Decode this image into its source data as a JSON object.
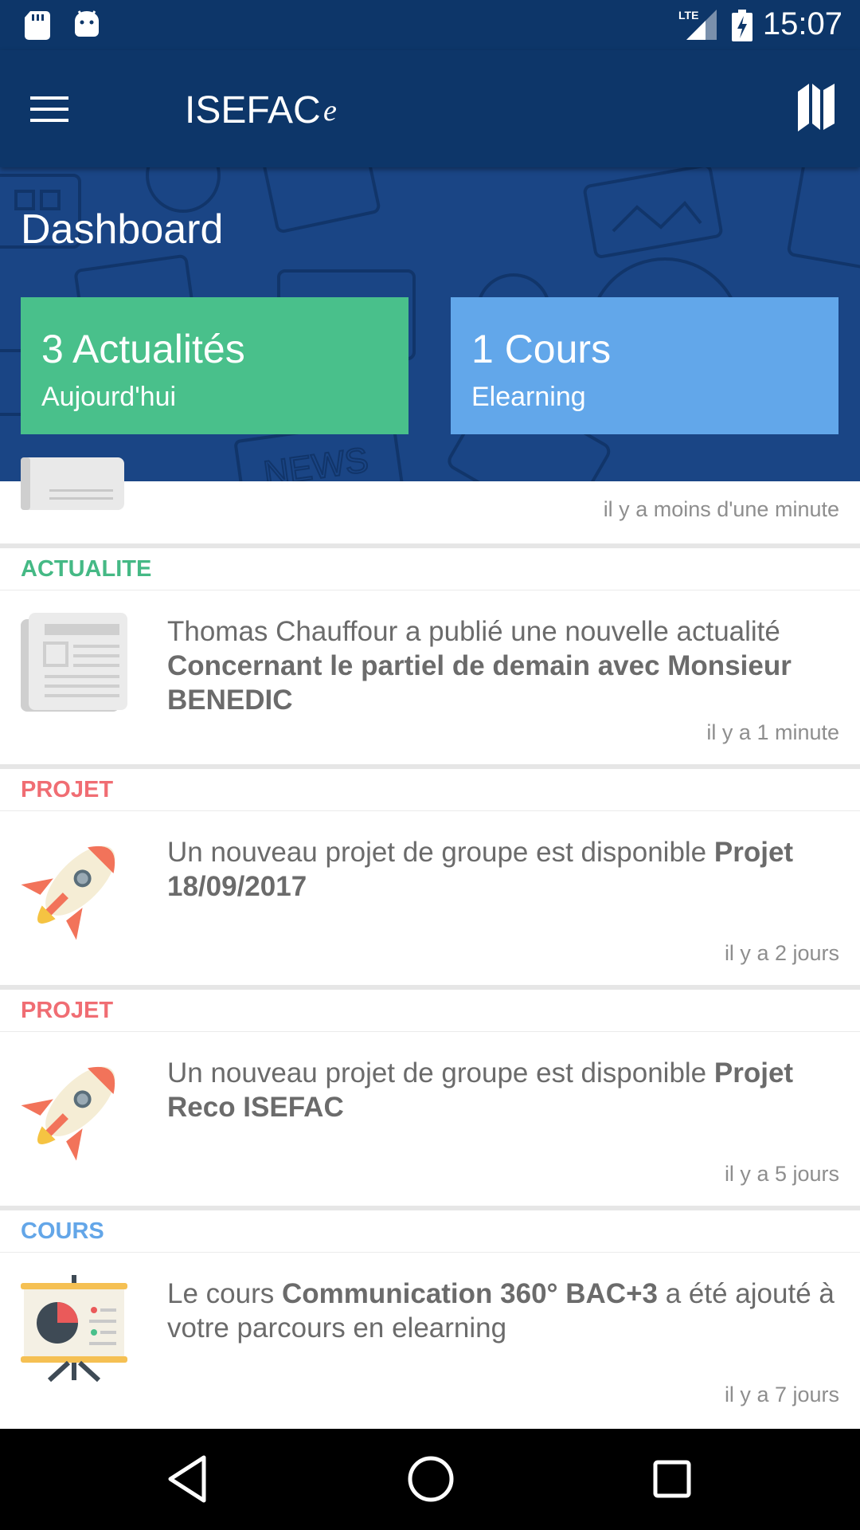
{
  "status_bar": {
    "time": "15:07",
    "network": "LTE",
    "icons": [
      "sd-card-icon",
      "android-icon",
      "lte-signal-icon",
      "battery-charging-icon"
    ]
  },
  "app_bar": {
    "title": "ISEFAC",
    "logo_letter": "e",
    "menu_icon": "hamburger-icon",
    "action_icon": "map-icon"
  },
  "hero": {
    "title": "Dashboard",
    "cards": [
      {
        "count": "3 Actualités",
        "sub": "Aujourd'hui",
        "color": "#49c08b"
      },
      {
        "count": "1 Cours",
        "sub": "Elearning",
        "color": "#62a7ea"
      }
    ]
  },
  "feed": {
    "partial_time": "il y a moins d'une minute",
    "items": [
      {
        "category": "ACTUALITE",
        "icon": "newspaper-icon",
        "text_plain": "Thomas Chauffour a publié une nouvelle actualité ",
        "text_bold": "Concernant le partiel de demain avec Monsieur BENEDIC",
        "text_after": "",
        "time": "il y a 1 minute"
      },
      {
        "category": "PROJET",
        "icon": "rocket-icon",
        "text_plain": "Un nouveau projet de groupe est disponible ",
        "text_bold": "Projet 18/09/2017",
        "text_after": "",
        "time": "il y a 2 jours"
      },
      {
        "category": "PROJET",
        "icon": "rocket-icon",
        "text_plain": "Un nouveau projet de groupe est disponible ",
        "text_bold": "Projet Reco ISEFAC",
        "text_after": "",
        "time": "il y a 5 jours"
      },
      {
        "category": "COURS",
        "icon": "presentation-board-icon",
        "text_plain": "Le cours ",
        "text_bold": "Communication 360° BAC+3",
        "text_after": " a été ajouté à votre parcours en elearning",
        "time": "il y a 7 jours"
      }
    ]
  },
  "colors": {
    "primary": "#0d3669",
    "actualite": "#45b985",
    "projet": "#f06d73",
    "cours": "#63a6e8"
  },
  "nav_bar": {
    "buttons": [
      "back-icon",
      "home-icon",
      "recents-icon"
    ]
  }
}
